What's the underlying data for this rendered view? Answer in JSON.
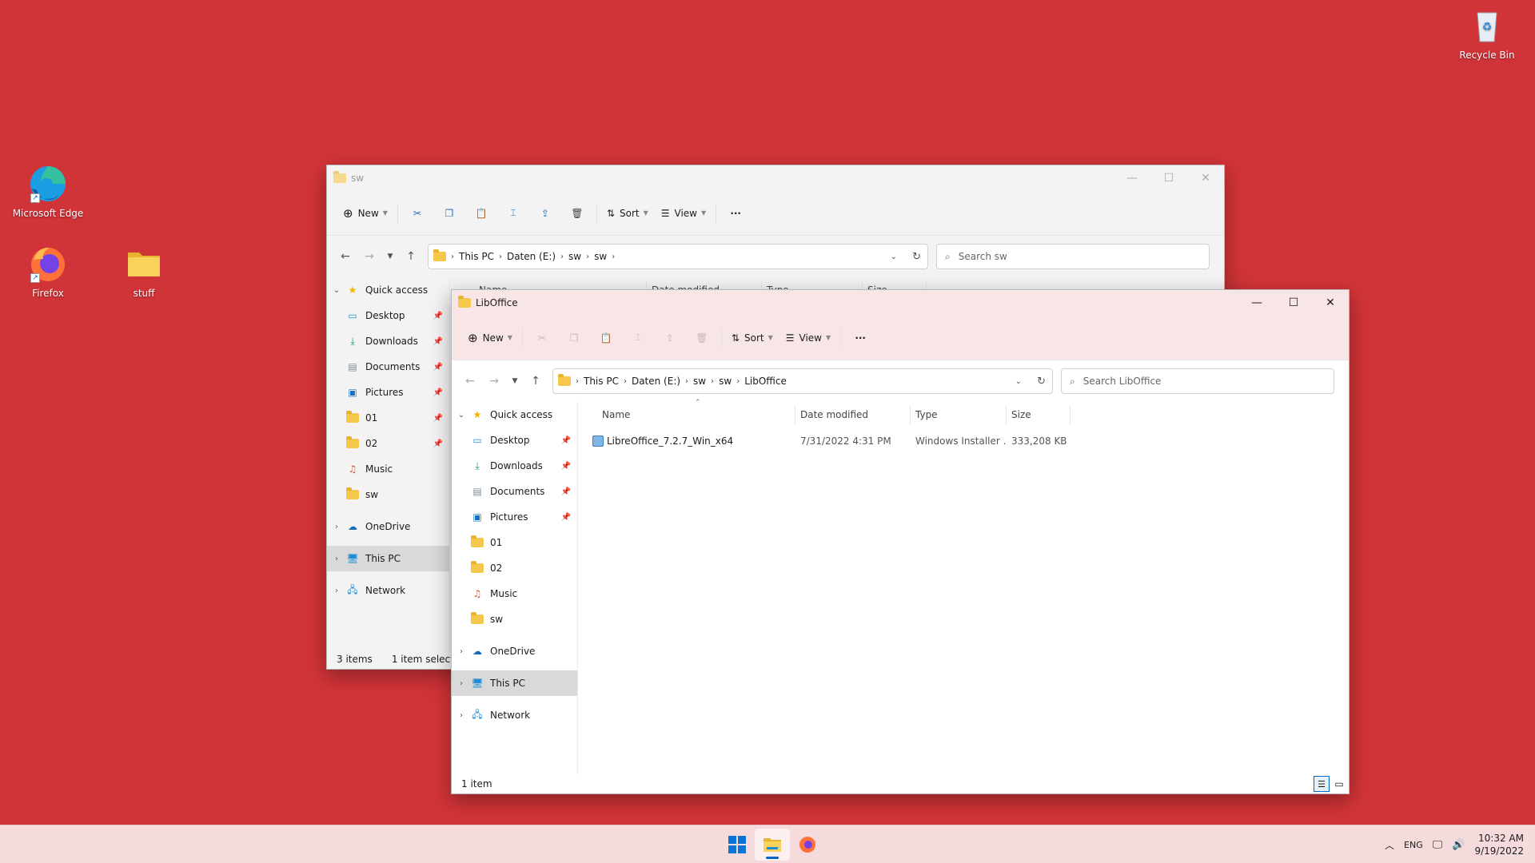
{
  "desktop": {
    "icons": [
      {
        "label": "Microsoft Edge"
      },
      {
        "label": "Firefox"
      },
      {
        "label": "stuff"
      },
      {
        "label": "Recycle Bin"
      }
    ]
  },
  "back_window": {
    "title": "sw",
    "toolbar": {
      "new_label": "New",
      "sort_label": "Sort",
      "view_label": "View"
    },
    "breadcrumb": [
      "This PC",
      "Daten (E:)",
      "sw",
      "sw"
    ],
    "search_placeholder": "Search sw",
    "columns": [
      "Name",
      "Date modified",
      "Type",
      "Size"
    ],
    "sidebar": {
      "quick_access": "Quick access",
      "items": [
        "Desktop",
        "Downloads",
        "Documents",
        "Pictures",
        "01",
        "02",
        "Music",
        "sw"
      ],
      "onedrive": "OneDrive",
      "this_pc": "This PC",
      "network": "Network"
    },
    "status": {
      "items": "3 items",
      "selected": "1 item selected"
    }
  },
  "front_window": {
    "title": "LibOffice",
    "toolbar": {
      "new_label": "New",
      "sort_label": "Sort",
      "view_label": "View"
    },
    "breadcrumb": [
      "This PC",
      "Daten (E:)",
      "sw",
      "sw",
      "LibOffice"
    ],
    "search_placeholder": "Search LibOffice",
    "columns": [
      "Name",
      "Date modified",
      "Type",
      "Size"
    ],
    "sidebar": {
      "quick_access": "Quick access",
      "items": [
        "Desktop",
        "Downloads",
        "Documents",
        "Pictures",
        "01",
        "02",
        "Music",
        "sw"
      ],
      "onedrive": "OneDrive",
      "this_pc": "This PC",
      "network": "Network"
    },
    "files": [
      {
        "name": "LibreOffice_7.2.7_Win_x64",
        "date": "7/31/2022 4:31 PM",
        "type": "Windows Installer ...",
        "size": "333,208 KB"
      }
    ],
    "status": {
      "items": "1 item"
    }
  },
  "taskbar": {
    "language": "ENG",
    "time": "10:32 AM",
    "date": "9/19/2022"
  },
  "colors": {
    "desktop_bg": "#d13438",
    "accent": "#0067c0",
    "folder": "#f5c84c"
  }
}
